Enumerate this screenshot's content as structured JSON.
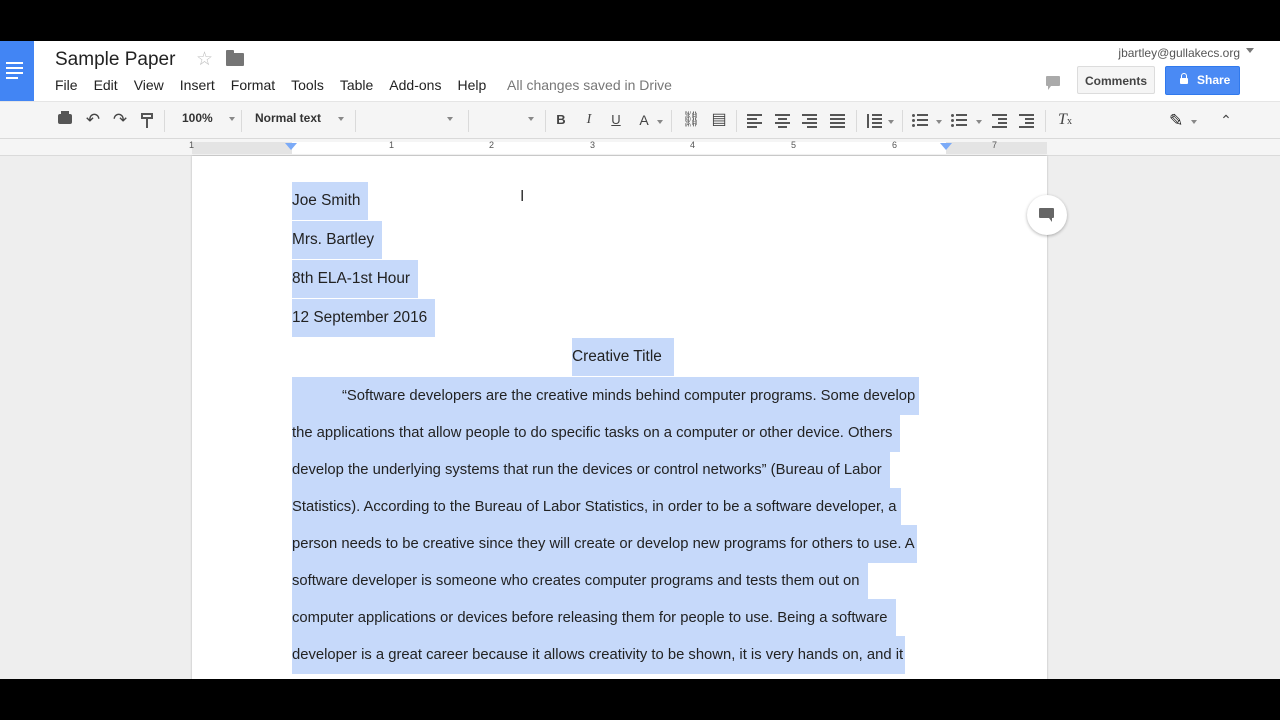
{
  "app": {
    "title": "Sample Paper",
    "save_status": "All changes saved in Drive",
    "user_email": "jbartley@gullakecs.org"
  },
  "menu": [
    "File",
    "Edit",
    "View",
    "Insert",
    "Format",
    "Tools",
    "Table",
    "Add-ons",
    "Help"
  ],
  "header_buttons": {
    "comments": "Comments",
    "share": "Share"
  },
  "toolbar": {
    "zoom": "100%",
    "style": "Normal text",
    "font": "",
    "font_size": "",
    "bold": "B",
    "italic": "I",
    "underline": "U",
    "text_color": "A"
  },
  "ruler": [
    "1",
    "1",
    "2",
    "3",
    "4",
    "5",
    "6",
    "7"
  ],
  "document": {
    "lines": [
      "Joe Smith",
      "Mrs. Bartley",
      "8th ELA-1st Hour",
      "12 September 2016",
      "Creative Title",
      "“Software developers are the creative minds behind computer programs. Some develop",
      "the applications that allow people to do specific tasks on a computer or other device. Others",
      "develop the underlying systems that run the devices or control networks” (Bureau of Labor",
      "Statistics). According to the Bureau of Labor Statistics, in order to be a software developer, a",
      "person needs to be creative since they will create or develop new programs for others to use. A",
      "software developer is someone who creates computer programs and tests them out on",
      "computer applications or devices before releasing them for people to use. Being a software",
      "developer is a great career because it allows creativity to be shown, it is very hands on, and it"
    ]
  },
  "colors": {
    "docs_blue": "#4285f4",
    "share_blue": "#4a8af4",
    "selection": "#c6d9fa"
  }
}
